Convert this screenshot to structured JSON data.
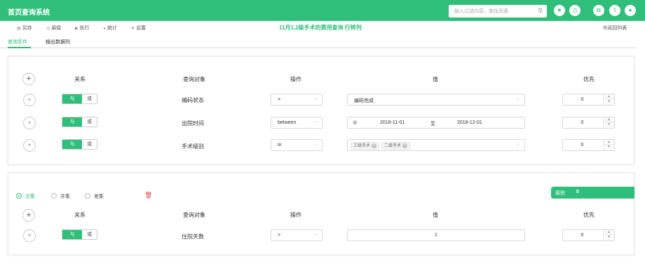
{
  "header": {
    "title": "首页查询系统",
    "search_placeholder": "输入过滤内容，查找页面",
    "icons": [
      "search-icon",
      "star-icon",
      "clock-icon",
      "export-icon",
      "upload-icon",
      "user-icon"
    ]
  },
  "toolbar": {
    "items": [
      {
        "icon": "save-icon",
        "label": "另存"
      },
      {
        "icon": "eye-icon",
        "label": "层级"
      },
      {
        "icon": "play-icon",
        "label": "执行"
      },
      {
        "icon": "stats-icon",
        "label": "统计"
      },
      {
        "icon": "settings-icon",
        "label": "设置"
      }
    ],
    "center_title": "11月1,2级手术的费用查询 行转列",
    "back_label": "返回列表"
  },
  "tabs": [
    {
      "label": "查询条件",
      "active": true
    },
    {
      "label": "输出数据列",
      "active": false
    }
  ],
  "columns": {
    "relation": "关系",
    "object": "查询对象",
    "operation": "操作",
    "value": "值",
    "priority": "优先"
  },
  "segment": {
    "and": "与",
    "or": "或"
  },
  "panel1": {
    "rows": [
      {
        "object": "编码状态",
        "op": "=",
        "value": "编码完成",
        "priority": "0"
      },
      {
        "object": "出院时间",
        "op": "between",
        "date_from": "2018-11-01",
        "date_sep": "至",
        "date_to": "2018-12-01",
        "priority": "0"
      },
      {
        "object": "手术级别",
        "op": "in",
        "tags": [
          "三级手术",
          "二级手术"
        ],
        "priority": "0"
      }
    ]
  },
  "panel2": {
    "set_ops": [
      {
        "label": "交集",
        "selected": true
      },
      {
        "label": "并集",
        "selected": false
      },
      {
        "label": "差集",
        "selected": false
      }
    ],
    "level_label": "级别",
    "level_value": "0",
    "rows": [
      {
        "object": "住院天数",
        "op": ">",
        "value": "1",
        "priority": "0"
      }
    ]
  },
  "colors": {
    "accent": "#2fbf7a",
    "danger": "#e05050"
  }
}
